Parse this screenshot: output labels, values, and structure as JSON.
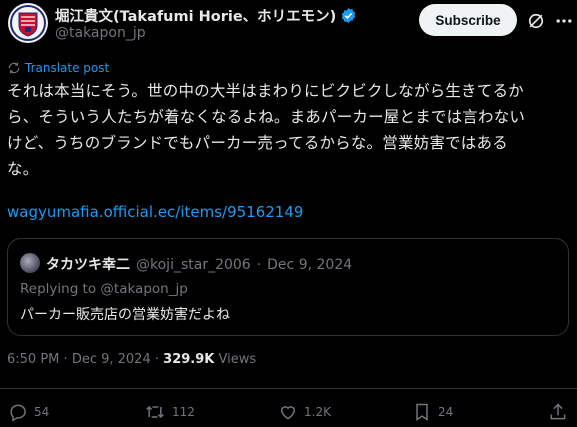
{
  "author": {
    "display_name": "堀江貴文(Takafumi Horie、ホリエモン)",
    "handle": "@takapon_jp",
    "verified_color": "#1d9bf0"
  },
  "header": {
    "subscribe_label": "Subscribe",
    "icons": [
      "grok-icon",
      "more-icon"
    ]
  },
  "translate_label": "Translate post",
  "post": {
    "lines": [
      "それは本当にそう。世の中の大半はまわりにビクビクしながら生きてるか",
      "ら、そういう人たちが着なくなるよね。まあパーカー屋とまでは言わない",
      "けど、うちのブランドでもパーカー売ってるからな。営業妨害ではある",
      "な。"
    ],
    "link": "wagyumafia.official.ec/items/95162149"
  },
  "quote": {
    "name": "タカツキ幸二",
    "handle": "@koji_star_2006",
    "separator": "·",
    "date": "Dec 9, 2024",
    "replying_to": "Replying to @takapon_jp",
    "text": "パーカー販売店の営業妨害だよね"
  },
  "meta": {
    "time": "6:50 PM",
    "separator": "·",
    "date": "Dec 9, 2024",
    "views_count": "329.9K",
    "views_label": "Views"
  },
  "actions": {
    "replies": "54",
    "reposts": "112",
    "likes": "1.2K",
    "bookmarks": "24"
  },
  "colors": {
    "background": "#000000",
    "text": "#e7e9ea",
    "muted": "#71767b",
    "accent": "#1d9bf0",
    "border": "#2f3336"
  }
}
